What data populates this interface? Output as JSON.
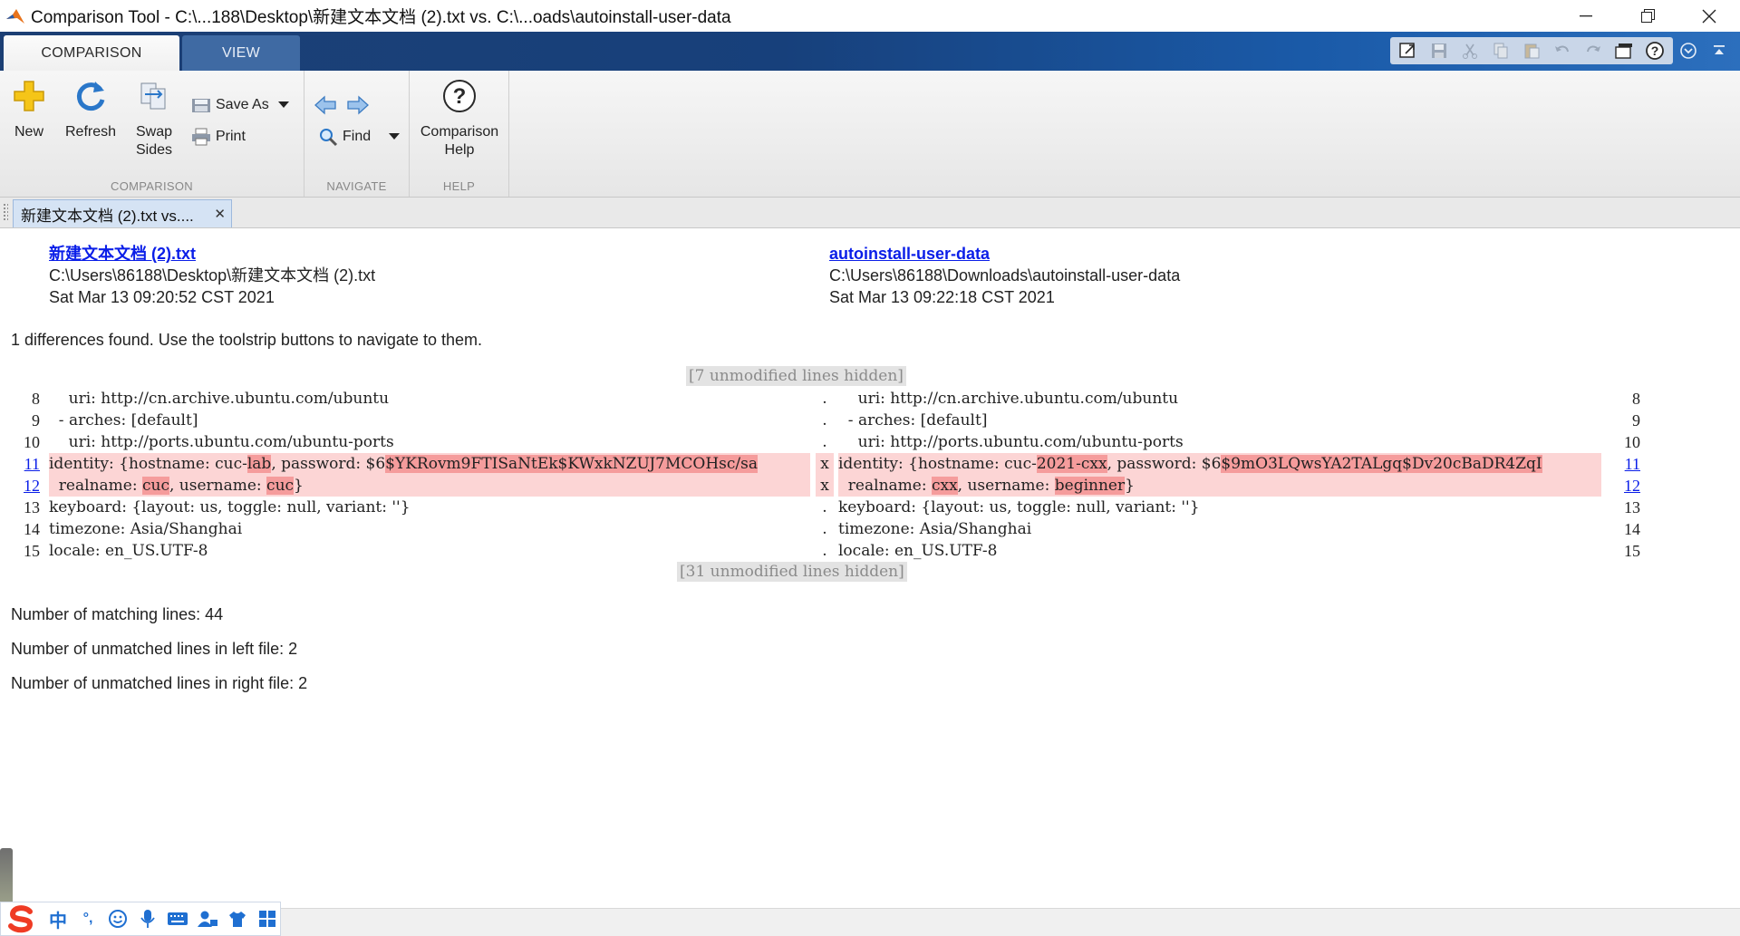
{
  "window": {
    "title": "Comparison Tool - C:\\...188\\Desktop\\新建文本文档 (2).txt vs. C:\\...oads\\autoinstall-user-data"
  },
  "ribbon_tabs": [
    {
      "label": "COMPARISON"
    },
    {
      "label": "VIEW"
    }
  ],
  "ribbon": {
    "comparison": {
      "new_label": "New",
      "refresh_label": "Refresh",
      "swap_label_1": "Swap",
      "swap_label_2": "Sides",
      "save_as_label": "Save As",
      "print_label": "Print",
      "group_label": "COMPARISON"
    },
    "navigate": {
      "find_label": "Find",
      "group_label": "NAVIGATE"
    },
    "help": {
      "help_label_1": "Comparison",
      "help_label_2": "Help",
      "group_label": "HELP"
    }
  },
  "document_tab": {
    "label": "新建文本文档 (2).txt vs...."
  },
  "report": {
    "left_file": {
      "name": "新建文本文档 (2).txt",
      "path": "C:\\Users\\86188\\Desktop\\新建文本文档 (2).txt",
      "date": "Sat Mar 13 09:20:52 CST 2021"
    },
    "right_file": {
      "name": "autoinstall-user-data",
      "path": "C:\\Users\\86188\\Downloads\\autoinstall-user-data",
      "date": "Sat Mar 13 09:22:18 CST 2021"
    },
    "summary": "1 differences found. Use the toolstrip buttons to navigate to them.",
    "hidden_top": "[7 unmodified lines hidden]",
    "hidden_bottom": "[31 unmodified lines hidden]",
    "rows": [
      {
        "ln_left": "8",
        "left": "    uri: http://cn.archive.ubuntu.com/ubuntu",
        "mark": ".",
        "right": "    uri: http://cn.archive.ubuntu.com/ubuntu",
        "ln_right": "8"
      },
      {
        "ln_left": "9",
        "left": "  - arches: [default]",
        "mark": ".",
        "right": "  - arches: [default]",
        "ln_right": "9"
      },
      {
        "ln_left": "10",
        "left": "    uri: http://ports.ubuntu.com/ubuntu-ports",
        "mark": ".",
        "right": "    uri: http://ports.ubuntu.com/ubuntu-ports",
        "ln_right": "10"
      },
      {
        "ln_left": "11",
        "left_segments": [
          "identity: {hostname: cuc-",
          "lab",
          ", password: $6",
          "$YKRovm9FTISaNtEk$KWxkNZUJ7MCOHsc/sa"
        ],
        "mark": "x",
        "right_segments": [
          "identity: {hostname: cuc-",
          "2021-cxx",
          ", password: $6",
          "$9mO3LQwsYA2TALgq$Dv20cBaDR4ZqI"
        ],
        "ln_right": "11"
      },
      {
        "ln_left": "12",
        "left_segments": [
          "  realname: ",
          "cuc",
          ", username: ",
          "cuc",
          "}"
        ],
        "mark": "x",
        "right_segments": [
          "  realname: ",
          "cxx",
          ", username: ",
          "beginner",
          "}"
        ],
        "ln_right": "12"
      },
      {
        "ln_left": "13",
        "left": "keyboard: {layout: us, toggle: null, variant: ''}",
        "mark": ".",
        "right": "keyboard: {layout: us, toggle: null, variant: ''}",
        "ln_right": "13"
      },
      {
        "ln_left": "14",
        "left": "timezone: Asia/Shanghai",
        "mark": ".",
        "right": "timezone: Asia/Shanghai",
        "ln_right": "14"
      },
      {
        "ln_left": "15",
        "left": "locale: en_US.UTF-8",
        "mark": ".",
        "right": "locale: en_US.UTF-8",
        "ln_right": "15"
      }
    ],
    "stats": {
      "matching": "Number of matching lines: 44",
      "unmatched_left": "Number of unmatched lines in left file: 2",
      "unmatched_right": "Number of unmatched lines in right file: 2"
    }
  },
  "ime_toolbar": {
    "lang": "中",
    "punct": "°,"
  },
  "colors": {
    "ribbon_blue": "#17407b",
    "diff_bg": "#fcd5d5",
    "diff_highlight": "#f59c9c",
    "link": "#0a1ee8"
  }
}
